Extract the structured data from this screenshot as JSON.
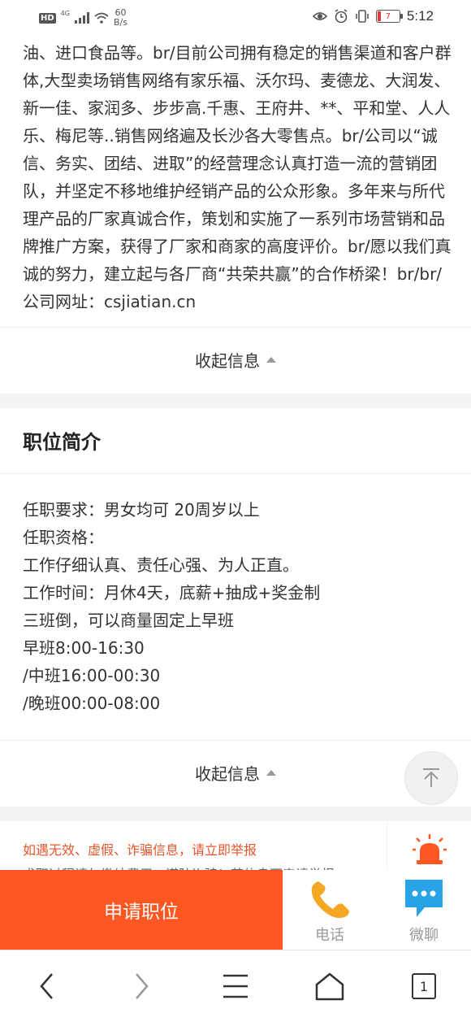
{
  "status_bar": {
    "hd": "HD",
    "network": "4G",
    "speed_value": "60",
    "speed_unit": "B/s",
    "battery": "7",
    "time": "5:12"
  },
  "company": {
    "text": "油、进口食品等。br/目前公司拥有稳定的销售渠道和客户群体,大型卖场销售网络有家乐福、沃尔玛、麦德龙、大润发、新一佳、家润多、步步高.千惠、王府井、**、平和堂、人人乐、梅尼等..销售网络遍及长沙各大零售点。br/公司以“诚信、务实、团结、进取”的经营理念认真打造一流的营销团队，并坚定不移地维护经销产品的公众形象。多年来与所代理产品的厂家真诚合作，策划和实施了一系列市场营销和品牌推广方案，获得了厂家和商家的高度评价。br/愿以我们真诚的努力，建立起与各厂商“共荣共赢”的合作桥梁！br/br/公司网址：csjiatian.cn",
    "collapse_label": "收起信息"
  },
  "job": {
    "section_title": "职位简介",
    "lines": [
      "任职要求：男女均可 20周岁以上",
      "任职资格：",
      "工作仔细认真、责任心强、为人正直。",
      "工作时间：月休4天，底薪+抽成+奖金制",
      "三班倒，可以商量固定上早班",
      "早班8:00-16:30",
      "/中班16:00-00:30",
      "/晚班00:00-08:00"
    ],
    "collapse_label": "收起信息"
  },
  "report": {
    "warning": "如遇无效、虚假、诈骗信息，请立即举报",
    "subtext": "求职过程请勿缴纳费用，谨防诈骗！若信息不实请举报"
  },
  "actions": {
    "apply_label": "申请职位",
    "phone_label": "电话",
    "chat_label": "微聊"
  },
  "browser_nav": {
    "tab_count": "1"
  },
  "colors": {
    "accent": "#ff5722",
    "warning_text": "#e8552a",
    "phone_icon": "#f5a623",
    "chat_icon": "#29a3e8",
    "alarm_icon": "#ff5722"
  }
}
